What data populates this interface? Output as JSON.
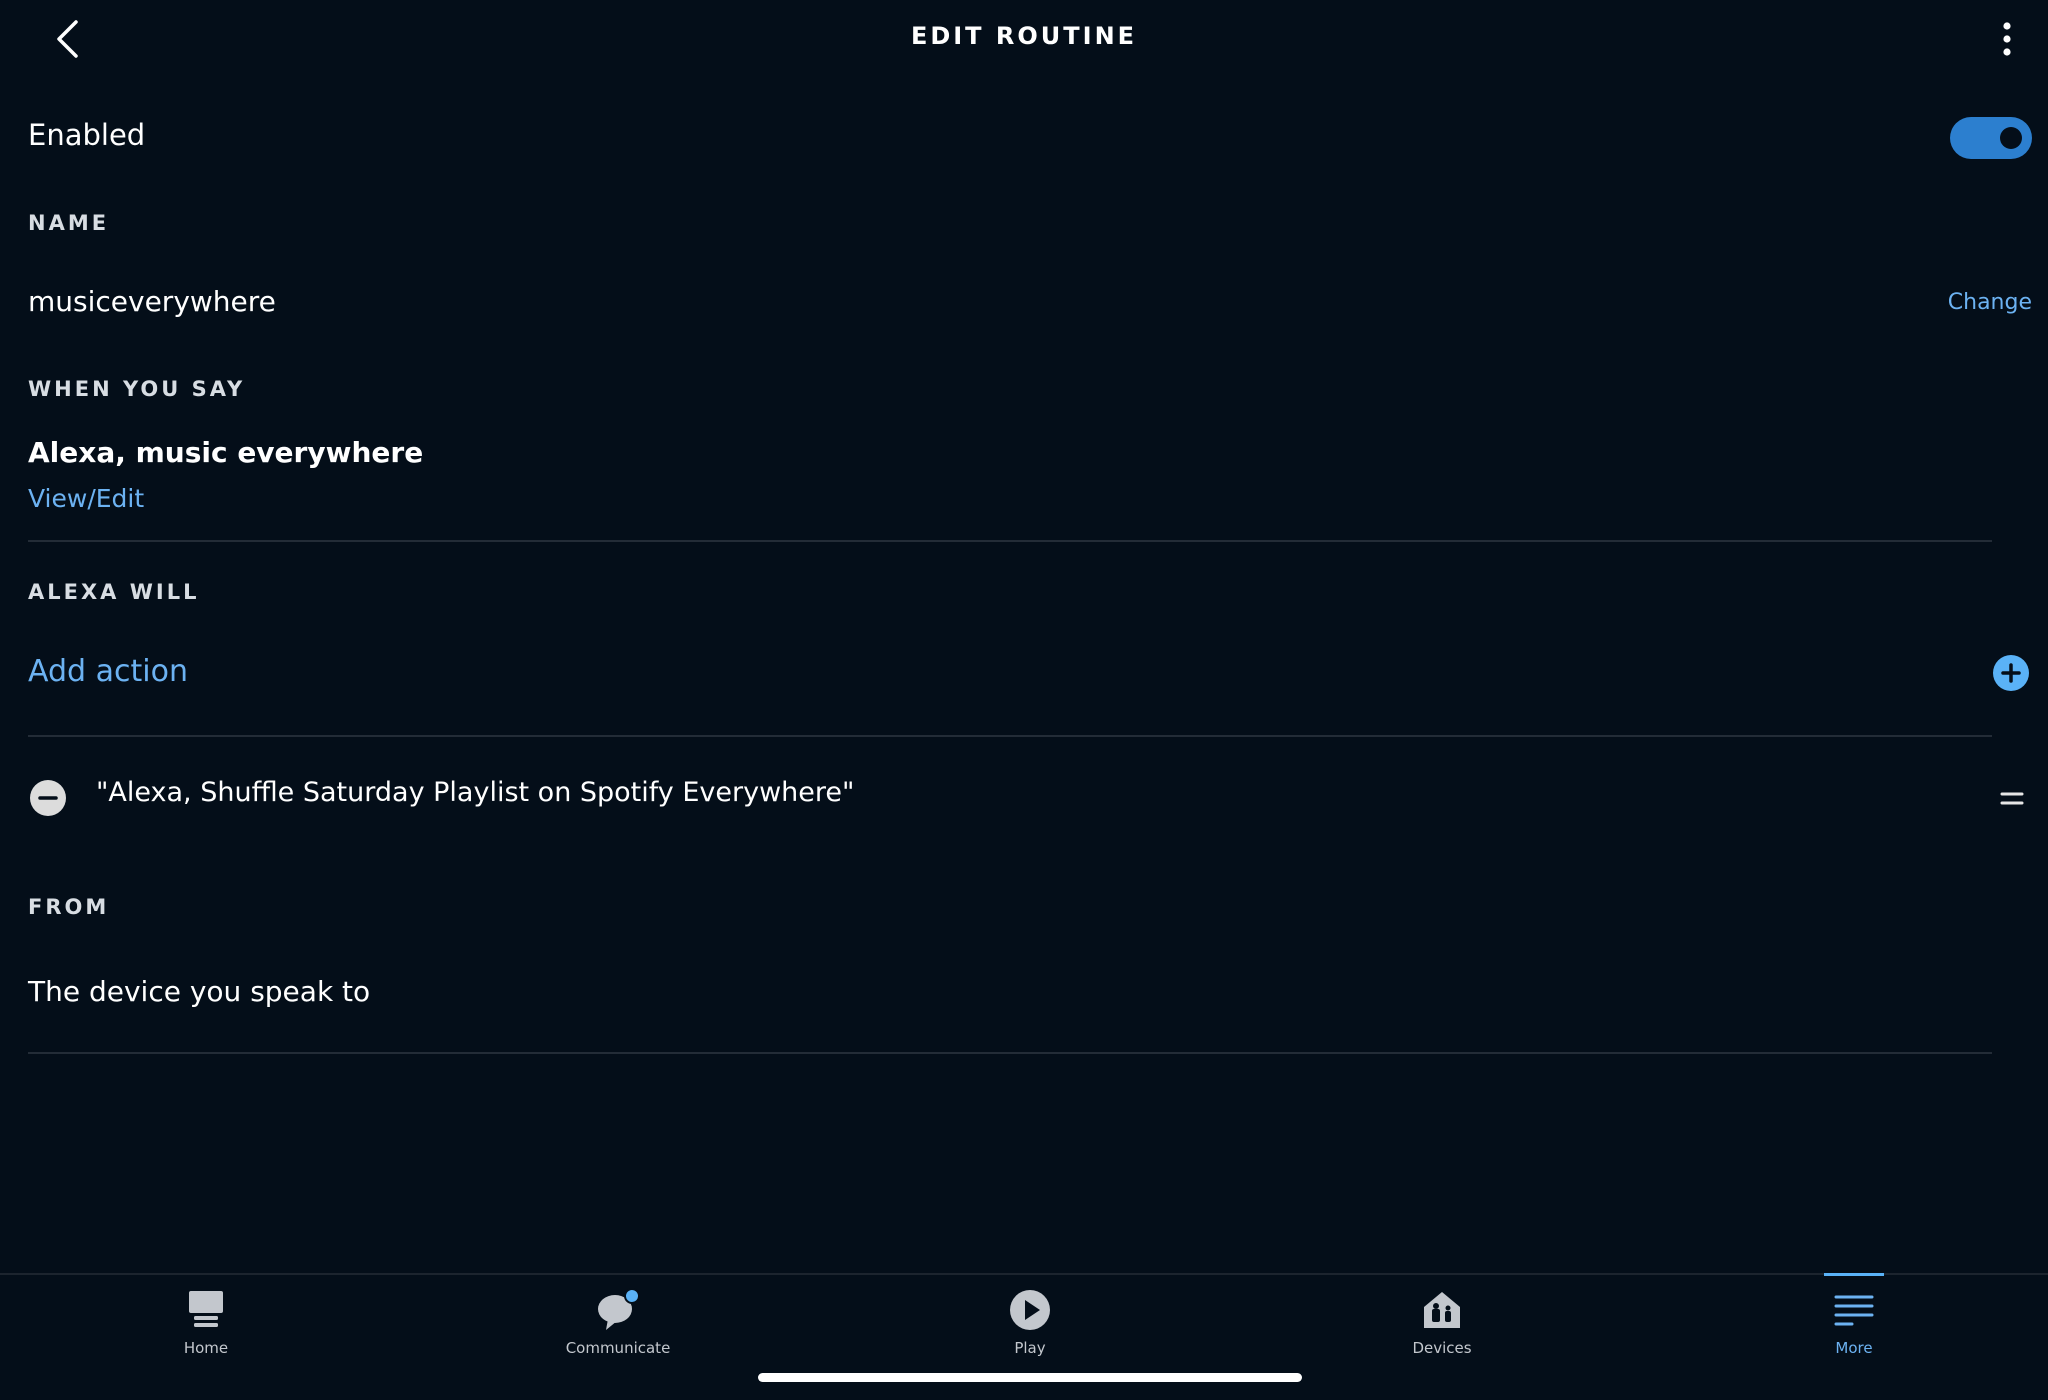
{
  "header": {
    "title": "EDIT ROUTINE",
    "back_icon": "chevron-left-icon",
    "menu_icon": "kebab-menu-icon"
  },
  "enabled": {
    "label": "Enabled",
    "state": true
  },
  "name_section": {
    "label": "NAME",
    "value": "musiceverywhere",
    "change_label": "Change"
  },
  "when_section": {
    "label": "WHEN YOU SAY",
    "phrase": "Alexa, music everywhere",
    "view_edit_label": "View/Edit"
  },
  "alexa_will_section": {
    "label": "ALEXA WILL",
    "add_action_label": "Add action",
    "actions": [
      {
        "text": "\"Alexa, Shuffle Saturday Playlist on Spotify Everywhere\""
      }
    ]
  },
  "from_section": {
    "label": "FROM",
    "value": "The device you speak to"
  },
  "tabbar": {
    "tabs": [
      {
        "label": "Home",
        "icon": "home-echo-icon",
        "active": false
      },
      {
        "label": "Communicate",
        "icon": "chat-bubble-icon",
        "active": false
      },
      {
        "label": "Play",
        "icon": "play-icon",
        "active": false
      },
      {
        "label": "Devices",
        "icon": "devices-house-icon",
        "active": false
      },
      {
        "label": "More",
        "icon": "hamburger-menu-icon",
        "active": true
      }
    ]
  },
  "colors": {
    "background": "#040e19",
    "accent": "#6cb2f2",
    "toggle_on": "#2c7fcf"
  }
}
